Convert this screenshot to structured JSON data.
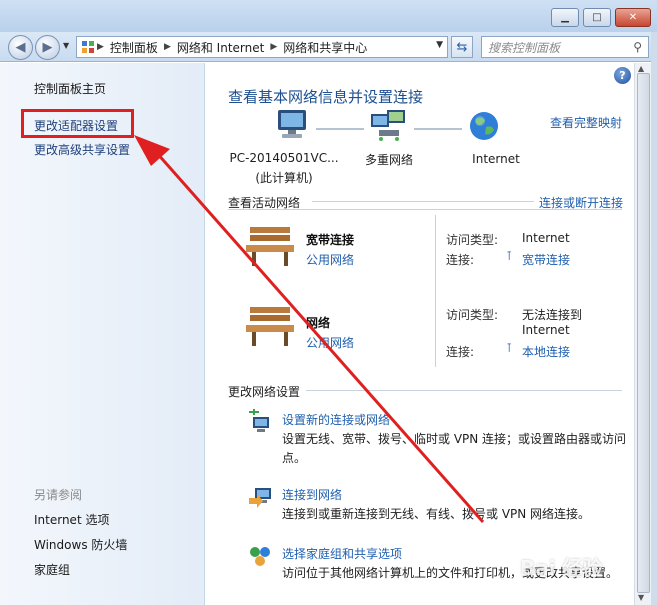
{
  "window": {
    "min_label": "▁",
    "max_label": "□",
    "close_label": "✕"
  },
  "navbar": {
    "breadcrumbs": [
      "控制面板",
      "网络和 Internet",
      "网络和共享中心"
    ],
    "search_placeholder": "搜索控制面板"
  },
  "sidebar": {
    "home_link": "控制面板主页",
    "links": [
      "更改适配器设置",
      "更改高级共享设置"
    ],
    "see_also_label": "另请参阅",
    "see_also_links": [
      "Internet 选项",
      "Windows 防火墙",
      "家庭组"
    ]
  },
  "main": {
    "title": "查看基本网络信息并设置连接",
    "full_map_link": "查看完整映射",
    "map": {
      "computer_name": "PC-20140501VC...",
      "computer_sub": "(此计算机)",
      "middle": "多重网络",
      "right": "Internet"
    },
    "active_header": "查看活动网络",
    "connect_link": "连接或断开连接",
    "networks": [
      {
        "name": "宽带连接",
        "category": "公用网络",
        "access_label": "访问类型:",
        "access_value": "Internet",
        "access_value2": "",
        "conn_label": "连接:",
        "conn_value": "宽带连接"
      },
      {
        "name": "网络",
        "category": "公用网络",
        "access_label": "访问类型:",
        "access_value": "无法连接到",
        "access_value2": "Internet",
        "conn_label": "连接:",
        "conn_value": "本地连接"
      }
    ],
    "change_header": "更改网络设置",
    "tasks": [
      {
        "link": "设置新的连接或网络",
        "desc": "设置无线、宽带、拨号、临时或 VPN 连接；或设置路由器或访问点。"
      },
      {
        "link": "连接到网络",
        "desc": "连接到或重新连接到无线、有线、拨号或 VPN 网络连接。"
      },
      {
        "link": "选择家庭组和共享选项",
        "desc": "访问位于其他网络计算机上的文件和打印机，或更改共享设置。"
      }
    ]
  },
  "watermark": "Bai 经验",
  "colors": {
    "link": "#1f5fae",
    "title": "#1d4f91",
    "highlight": "#e02020",
    "arrow": "#e02020"
  }
}
